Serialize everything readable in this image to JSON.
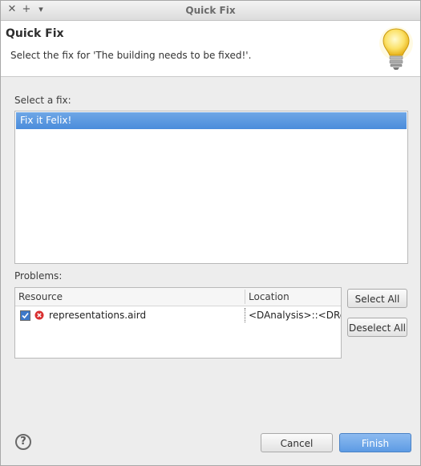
{
  "window": {
    "title": "Quick Fix",
    "buttons": {
      "close": "✕",
      "maximize": "+",
      "menu": "▾"
    }
  },
  "header": {
    "title": "Quick Fix",
    "message": "Select the fix for 'The building needs to be fixed!'.",
    "icon": "lightbulb-icon"
  },
  "fixes": {
    "label": "Select a fix:",
    "items": [
      "Fix it Felix!"
    ],
    "selected": 0
  },
  "problems": {
    "label": "Problems:",
    "columns": {
      "resource": "Resource",
      "location": "Location"
    },
    "rows": [
      {
        "checked": true,
        "resource": "representations.aird",
        "location": "<DAnalysis>::<DRep"
      }
    ]
  },
  "buttons": {
    "select_all": "Select All",
    "deselect_all": "Deselect All",
    "cancel": "Cancel",
    "finish": "Finish",
    "help": "?"
  },
  "colors": {
    "selection": "#4a8cdb",
    "error": "#d93030",
    "accent": "#5d9be4"
  }
}
